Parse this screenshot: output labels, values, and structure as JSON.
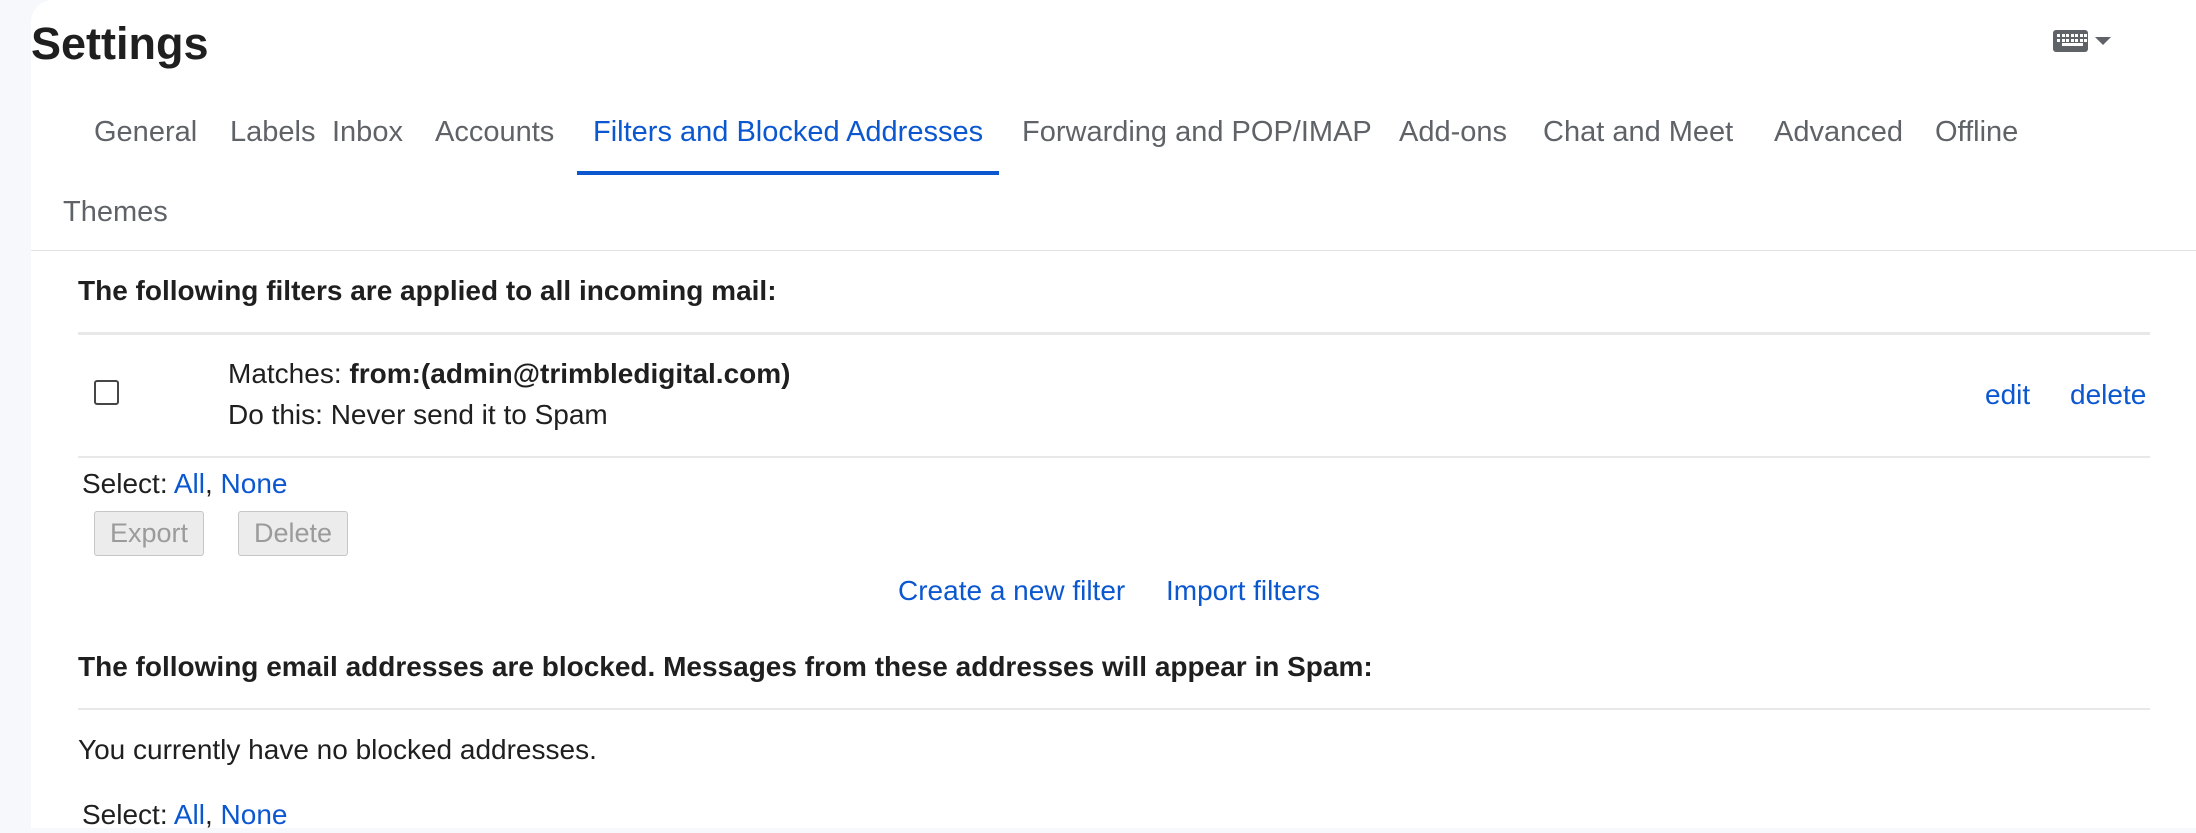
{
  "page": {
    "title": "Settings"
  },
  "tabs": [
    {
      "label": "General"
    },
    {
      "label": "Labels"
    },
    {
      "label": "Inbox"
    },
    {
      "label": "Accounts"
    },
    {
      "label": "Filters and Blocked Addresses",
      "active": true
    },
    {
      "label": "Forwarding and POP/IMAP"
    },
    {
      "label": "Add-ons"
    },
    {
      "label": "Chat and Meet"
    },
    {
      "label": "Advanced"
    },
    {
      "label": "Offline"
    },
    {
      "label": "Themes"
    }
  ],
  "filters": {
    "heading": "The following filters are applied to all incoming mail:",
    "items": [
      {
        "matches_label": "Matches: ",
        "matches_value": "from:(admin@trimbledigital.com)",
        "action": "Do this: Never send it to Spam",
        "edit_label": "edit",
        "delete_label": "delete",
        "checked": false
      }
    ],
    "select_label": "Select: ",
    "select_all": "All",
    "select_sep": ", ",
    "select_none": "None",
    "export_button": "Export",
    "delete_button": "Delete",
    "create_filter_link": "Create a new filter",
    "import_filters_link": "Import filters"
  },
  "blocked": {
    "heading": "The following email addresses are blocked. Messages from these addresses will appear in Spam:",
    "empty_text": "You currently have no blocked addresses.",
    "select_label": "Select: ",
    "select_all": "All",
    "select_sep": ", ",
    "select_none": "None"
  },
  "colors": {
    "accent": "#0b57d0",
    "text": "#1f1f1f",
    "muted": "#5f6368",
    "background": "#f6f8fc"
  },
  "icons": {
    "input_tools": "keyboard-icon",
    "input_tools_menu": "caret-down-icon"
  }
}
